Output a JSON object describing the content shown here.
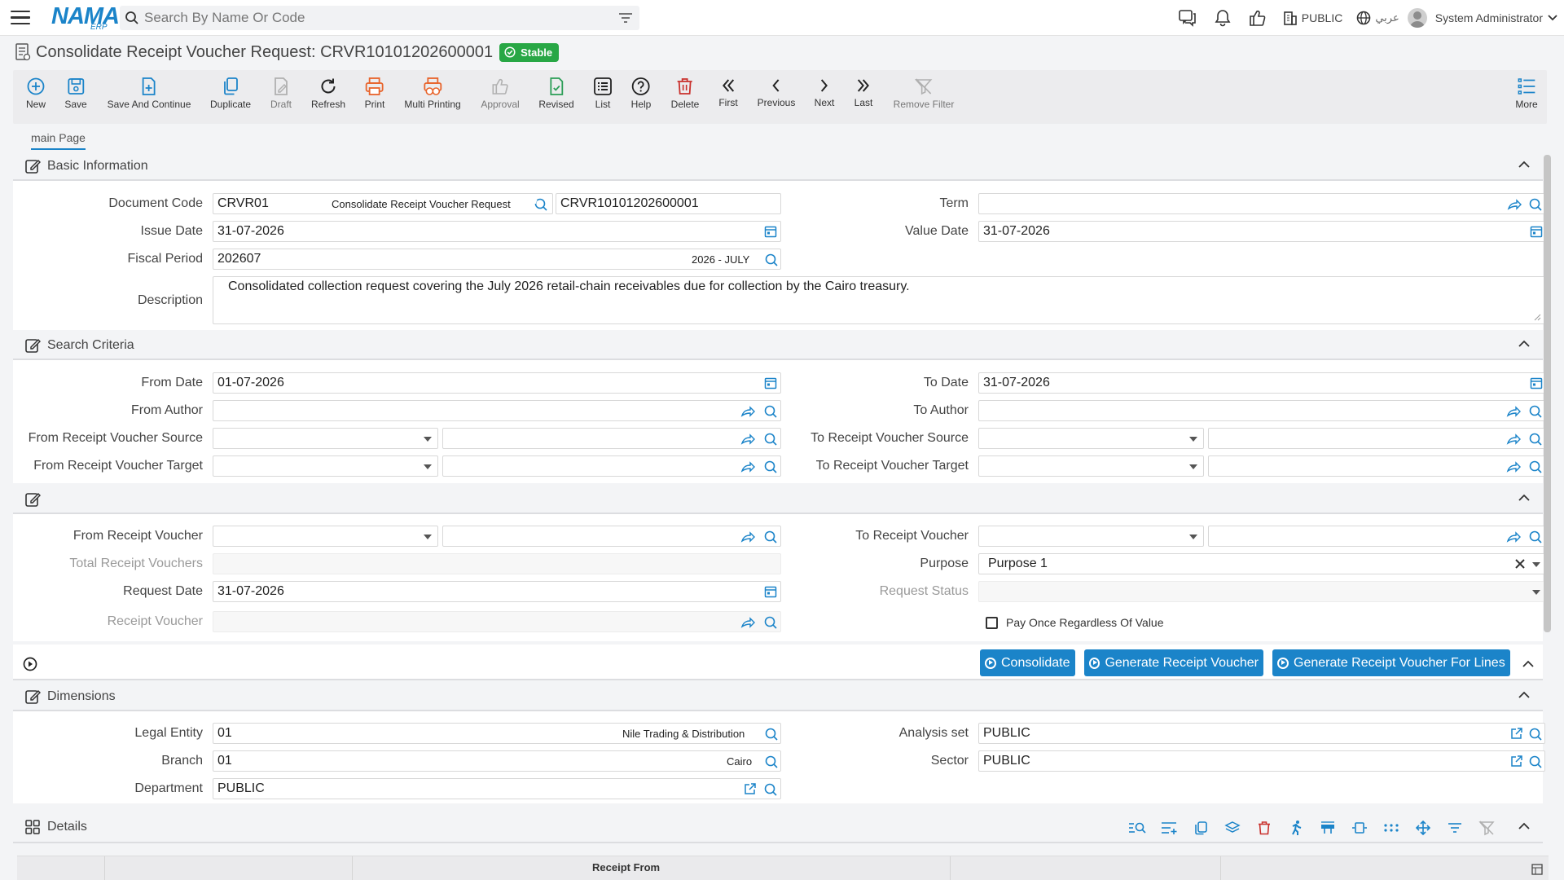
{
  "header": {
    "logo_main": "NAMA",
    "logo_sub": "ERP",
    "search_placeholder": "Search By Name Or Code",
    "org": "PUBLIC",
    "lang": "عربي",
    "user": "System Administrator"
  },
  "page": {
    "title": "Consolidate Receipt Voucher Request: CRVR10101202600001",
    "status": "Stable"
  },
  "toolbar": [
    {
      "label": "New",
      "icon": "plus-circle-icon"
    },
    {
      "label": "Save",
      "icon": "save-icon"
    },
    {
      "label": "Save And Continue",
      "icon": "save-continue-icon"
    },
    {
      "label": "Duplicate",
      "icon": "duplicate-icon"
    },
    {
      "label": "Draft",
      "icon": "draft-icon"
    },
    {
      "label": "Refresh",
      "icon": "refresh-icon"
    },
    {
      "label": "Print",
      "icon": "print-icon"
    },
    {
      "label": "Multi Printing",
      "icon": "multi-print-icon"
    },
    {
      "label": "Approval",
      "icon": "thumb-up-icon"
    },
    {
      "label": "Revised",
      "icon": "revised-icon"
    },
    {
      "label": "List",
      "icon": "list-icon"
    },
    {
      "label": "Help",
      "icon": "help-icon"
    },
    {
      "label": "Delete",
      "icon": "trash-icon"
    },
    {
      "label": "First",
      "icon": "first-icon"
    },
    {
      "label": "Previous",
      "icon": "previous-icon"
    },
    {
      "label": "Next",
      "icon": "next-icon"
    },
    {
      "label": "Last",
      "icon": "last-icon"
    },
    {
      "label": "Remove Filter",
      "icon": "remove-filter-icon"
    },
    {
      "label": "More",
      "icon": "more-icon"
    }
  ],
  "tabs": [
    "main Page"
  ],
  "basic": {
    "title": "Basic Information",
    "document_code_label": "Document Code",
    "document_code": "CRVR01",
    "document_code_name": "Consolidate Receipt Voucher Request",
    "document_number": "CRVR10101202600001",
    "term_label": "Term",
    "term": "",
    "issue_date_label": "Issue Date",
    "issue_date": "31-07-2026",
    "value_date_label": "Value Date",
    "value_date": "31-07-2026",
    "fiscal_period_label": "Fiscal Period",
    "fiscal_period": "202607",
    "fiscal_period_name": "2026 - JULY",
    "description_label": "Description",
    "description": "Consolidated collection request covering the July 2026 retail-chain receivables due for collection by the Cairo treasury."
  },
  "search": {
    "title": "Search Criteria",
    "from_date_label": "From Date",
    "from_date": "01-07-2026",
    "to_date_label": "To Date",
    "to_date": "31-07-2026",
    "from_author_label": "From Author",
    "to_author_label": "To Author",
    "from_source_label": "From Receipt Voucher Source",
    "to_source_label": "To Receipt Voucher Source",
    "from_target_label": "From Receipt Voucher Target",
    "to_target_label": "To Receipt Voucher Target"
  },
  "voucher": {
    "from_rv_label": "From Receipt Voucher",
    "to_rv_label": "To Receipt Voucher",
    "total_label": "Total Receipt Vouchers",
    "purpose_label": "Purpose",
    "purpose": "Purpose 1",
    "request_date_label": "Request Date",
    "request_date": "31-07-2026",
    "request_status_label": "Request Status",
    "receipt_voucher_label": "Receipt Voucher",
    "pay_once_label": "Pay Once Regardless Of Value"
  },
  "actions": {
    "consolidate": "Consolidate",
    "generate_rv": "Generate Receipt Voucher",
    "generate_rv_lines": "Generate Receipt Voucher For Lines"
  },
  "dimensions": {
    "title": "Dimensions",
    "legal_entity_label": "Legal Entity",
    "legal_entity": "01",
    "legal_entity_name": "Nile Trading & Distribution",
    "analysis_set_label": "Analysis set",
    "analysis_set": "PUBLIC",
    "branch_label": "Branch",
    "branch": "01",
    "branch_name": "Cairo",
    "sector_label": "Sector",
    "sector": "PUBLIC",
    "department_label": "Department",
    "department": "PUBLIC"
  },
  "details": {
    "title": "Details",
    "col_receipt_from": "Receipt From"
  }
}
